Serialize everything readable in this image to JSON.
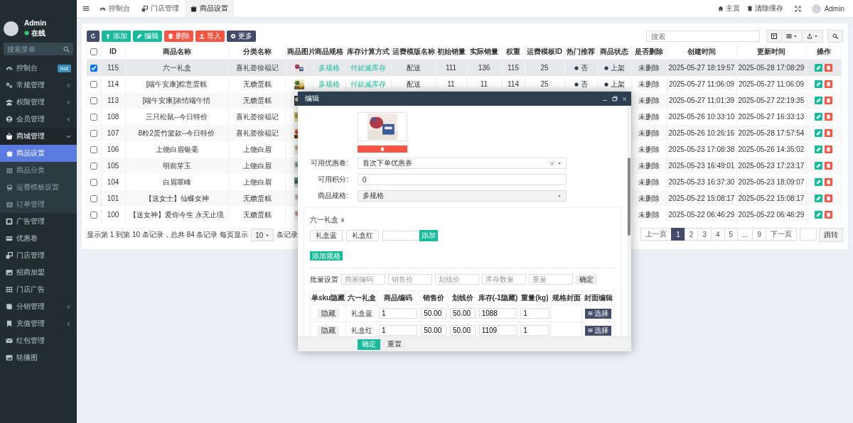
{
  "sidebar": {
    "user": {
      "name": "Admin",
      "status": "在线"
    },
    "search": {
      "placeholder": "搜索菜单"
    },
    "items": [
      {
        "label": "控制台",
        "kind": "link",
        "badge": "hot",
        "selected": false
      },
      {
        "label": "常规管理",
        "kind": "group",
        "expanded": false,
        "selected": false
      },
      {
        "label": "权限管理",
        "kind": "group",
        "expanded": false,
        "selected": false
      },
      {
        "label": "会员管理",
        "kind": "group",
        "expanded": false,
        "selected": false
      },
      {
        "label": "商城管理",
        "kind": "group",
        "expanded": true,
        "selected": false,
        "children": [
          {
            "label": "商品设置",
            "selected": true
          },
          {
            "label": "商品分类",
            "selected": false
          },
          {
            "label": "运费模板设置",
            "selected": false
          },
          {
            "label": "订单管理",
            "selected": false
          }
        ]
      },
      {
        "label": "广告管理",
        "kind": "link",
        "selected": false
      },
      {
        "label": "优惠卷",
        "kind": "link",
        "selected": false
      },
      {
        "label": "门店管理",
        "kind": "link",
        "selected": false
      },
      {
        "label": "招商加盟",
        "kind": "link",
        "selected": false
      },
      {
        "label": "门店广告",
        "kind": "link",
        "selected": false
      },
      {
        "label": "分销管理",
        "kind": "group",
        "expanded": false,
        "selected": false
      },
      {
        "label": "充值管理",
        "kind": "group",
        "expanded": false,
        "selected": false
      },
      {
        "label": "红包管理",
        "kind": "link",
        "selected": false
      },
      {
        "label": "轮播图",
        "kind": "link",
        "selected": false
      }
    ]
  },
  "topbar": {
    "tabs": [
      {
        "label": "控制台",
        "selected": false
      },
      {
        "label": "门店管理",
        "selected": false
      },
      {
        "label": "商品设置",
        "selected": true
      }
    ],
    "links": [
      "主页",
      "清除缓存"
    ],
    "user": "Admin"
  },
  "toolbar": {
    "buttons": [
      {
        "kind": "refresh"
      },
      {
        "kind": "add",
        "label": "添加"
      },
      {
        "kind": "edit",
        "label": "编辑"
      },
      {
        "kind": "delete",
        "label": "删除"
      },
      {
        "kind": "import",
        "label": "导入"
      },
      {
        "kind": "more",
        "label": "更多"
      }
    ],
    "search": {
      "placeholder": "搜索"
    }
  },
  "table": {
    "select_all": {
      "checked": false
    },
    "columns": [
      "ID",
      "商品名称",
      "分类名称",
      "商品图片",
      "商品规格",
      "库存计算方式",
      "运费模版名称",
      "初始销量",
      "实际销量",
      "权重",
      "运费模板ID",
      "热门推荐",
      "商品状态",
      "是否删除",
      "创建时间",
      "更新时间",
      "操作"
    ],
    "rows": [
      {
        "selected": true,
        "id": "115",
        "name": "六一礼盒",
        "category": "喜礼荟徐福记",
        "spec": "多规格",
        "stock_mode": "付款减库存",
        "shipping": "配送",
        "initial_sales": "111",
        "actual_sales": "136",
        "weight": "115",
        "shipping_id": "25",
        "hot": "否",
        "status": "上架",
        "deleted": "未删除",
        "created": "2025-05-27 18:19:57",
        "updated": "2025-05-28 17:08:29"
      },
      {
        "selected": false,
        "id": "114",
        "name": "[端午安康]粽意蛋糕",
        "category": "无糖蛋糕",
        "spec": "多规格",
        "stock_mode": "付款减库存",
        "shipping": "配送",
        "initial_sales": "11",
        "actual_sales": "11",
        "weight": "114",
        "shipping_id": "25",
        "hot": "否",
        "status": "上架",
        "deleted": "未删除",
        "created": "2025-05-27 11:06:09",
        "updated": "2025-05-27 11:06:09"
      },
      {
        "selected": false,
        "id": "113",
        "name": "[端午安康]浓情端午情",
        "category": "无糖蛋糕",
        "deleted": "未删除",
        "created": "2025-05-27 11:01:39",
        "updated": "2025-05-27 22:19:35"
      },
      {
        "selected": false,
        "id": "108",
        "name": "三只松鼠--今日特价",
        "category": "喜礼荟徐福记",
        "deleted": "未删除",
        "created": "2025-05-26 10:33:10",
        "updated": "2025-05-27 16:33:13"
      },
      {
        "selected": false,
        "id": "107",
        "name": "8粒2蛋竹篮款--今日特价",
        "category": "喜礼荟徐福记",
        "deleted": "未删除",
        "created": "2025-05-26 10:26:16",
        "updated": "2025-05-28 17:57:54"
      },
      {
        "selected": false,
        "id": "106",
        "name": "上饶白眉银毫",
        "category": "上饶白眉",
        "deleted": "未删除",
        "created": "2025-05-23 17:08:38",
        "updated": "2025-05-26 14:35:02"
      },
      {
        "selected": false,
        "id": "105",
        "name": "明前芽玉",
        "category": "上饶白眉",
        "deleted": "未删除",
        "created": "2025-05-23 16:49:01",
        "updated": "2025-05-23 17:23:17"
      },
      {
        "selected": false,
        "id": "104",
        "name": "白眉翠峰",
        "category": "上饶白眉",
        "deleted": "未删除",
        "created": "2025-05-23 16:37:30",
        "updated": "2025-05-23 18:09:07"
      },
      {
        "selected": false,
        "id": "101",
        "name": "【送女士】仙蝶女神",
        "category": "无糖蛋糕",
        "deleted": "未删除",
        "created": "2025-05-22 15:08:17",
        "updated": "2025-05-22 15:08:17"
      },
      {
        "selected": false,
        "id": "100",
        "name": "【送女神】爱你今生 永无止境",
        "category": "无糖蛋糕",
        "deleted": "未删除",
        "created": "2025-05-22 06:46:29",
        "updated": "2025-05-22 06:46:29"
      }
    ]
  },
  "pagination": {
    "summary": "显示第 1 到第 10 条记录，总共 84 条记录 每页显示",
    "page_size": "10",
    "summary_end": "条记录",
    "prev": "上一页",
    "pages": [
      {
        "label": "1",
        "selected": true
      },
      {
        "label": "2",
        "selected": false
      },
      {
        "label": "3",
        "selected": false
      },
      {
        "label": "4",
        "selected": false
      },
      {
        "label": "5",
        "selected": false
      },
      {
        "label": "...",
        "selected": false
      },
      {
        "label": "9",
        "selected": false
      }
    ],
    "next": "下一页",
    "jump": "跳转"
  },
  "modal": {
    "title": "编辑",
    "fields": [
      {
        "kind": "select",
        "label": "可用优惠卷:",
        "value": "首次下单优惠券",
        "clearable": true,
        "disabled": false
      },
      {
        "kind": "input",
        "label": "可用积分:",
        "value": "0",
        "disabled": false
      },
      {
        "kind": "select",
        "label": "商品规格:",
        "value": "多规格",
        "clearable": false,
        "disabled": true
      }
    ],
    "spec": {
      "name": "六一礼盒",
      "values": [
        "礼盒蓝",
        "礼盒红"
      ],
      "add_button": "添加",
      "add_spec_button": "添加规格",
      "batch": {
        "label": "批量设置",
        "placeholders": [
          "商家编码",
          "销售价",
          "划线价",
          "库存数量",
          "重量"
        ],
        "button": "确定"
      },
      "sku_columns": [
        "单sku隐藏",
        "六一礼盒",
        "商品编码",
        "销售价",
        "划线价",
        "库存(-1隐藏)",
        "重量(kg)",
        "规格封面",
        "封面编辑"
      ],
      "sku_rows": [
        {
          "hide": "隐藏",
          "value": "礼盒蓝",
          "code": "1",
          "price": "50.00",
          "list_price": "50.00",
          "stock": "1088",
          "weight": "1",
          "cover_button": "选择"
        },
        {
          "hide": "隐藏",
          "value": "礼盒红",
          "code": "1",
          "price": "50.00",
          "list_price": "50.00",
          "stock": "1109",
          "weight": "1",
          "cover_button": "选择"
        }
      ]
    },
    "footer": [
      "确定",
      "重置"
    ]
  }
}
